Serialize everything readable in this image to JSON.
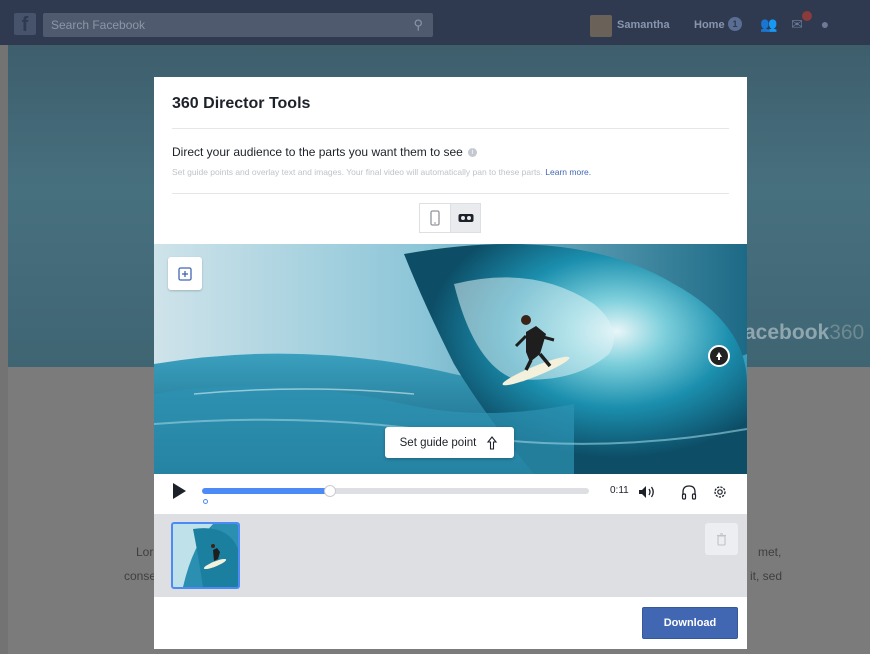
{
  "facebook": {
    "logo": "f",
    "search_placeholder": "Search Facebook",
    "user_name": "Samantha",
    "home_label": "Home",
    "home_count": "1",
    "cover_brand": "acebook",
    "cover_brand_suffix": "360"
  },
  "background_text": {
    "left_line1": "Lor",
    "left_line2": "conse",
    "right_line1": "met,",
    "right_line2": "it, sed"
  },
  "modal": {
    "title": "360 Director Tools",
    "subtitle": "Direct your audience to the parts you want them to see",
    "description": "Set guide points and overlay text and images. Your final video will automatically pan to these parts.",
    "learn_more": "Learn more.",
    "view_modes": [
      "mobile-icon",
      "vr-headset-icon"
    ],
    "active_view": "vr-headset-icon"
  },
  "video": {
    "guide_point_label": "Set guide point"
  },
  "player": {
    "time": "0:11",
    "progress": 0.33
  },
  "actions": {
    "download_label": "Download"
  },
  "colors": {
    "accent": "#4267b2",
    "progress": "#4c8bf5"
  }
}
